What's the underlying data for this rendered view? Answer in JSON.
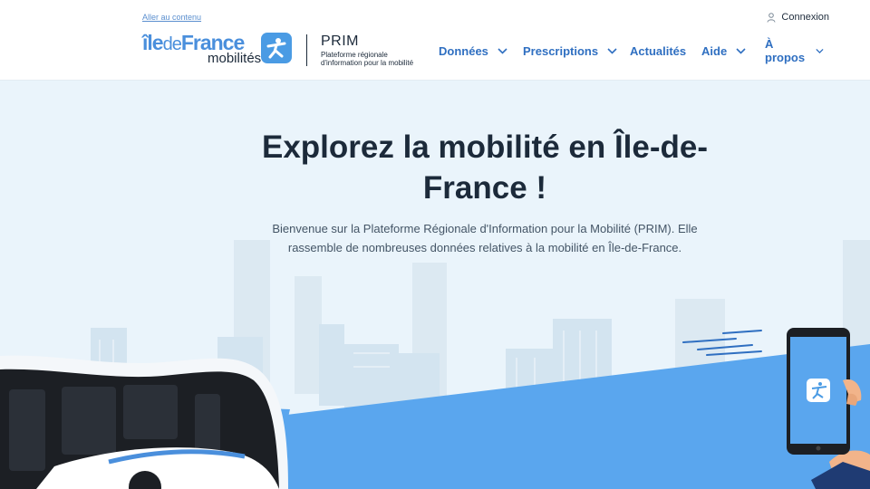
{
  "header": {
    "skip_link": "Aller au contenu",
    "login_label": "Connexion",
    "logo": {
      "main_part1": "île",
      "main_part2": "de",
      "main_part3": "France",
      "sub": "mobilités",
      "icon": "idfm-person-icon"
    },
    "platform": {
      "title": "PRIM",
      "subtitle": "Plateforme régionale d'information pour la mobilité"
    },
    "nav": [
      {
        "label": "Données",
        "has_dropdown": true
      },
      {
        "label": "Prescriptions",
        "has_dropdown": true
      },
      {
        "label": "Actualités",
        "has_dropdown": false
      },
      {
        "label": "Aide",
        "has_dropdown": true
      },
      {
        "label": "À propos",
        "has_dropdown": true
      }
    ]
  },
  "hero": {
    "title": "Explorez la mobilité en Île-de-France !",
    "description": "Bienvenue sur la Plateforme Régionale d'Information pour la Mobilité (PRIM). Elle rassemble de nombreuses données relatives à la mobilité en Île-de-France."
  },
  "colors": {
    "brand_blue": "#4a9be4",
    "nav_blue": "#2f6fc1",
    "text_dark": "#1c2a3a",
    "hero_bg": "#eaf4fb",
    "ground_blue": "#5aa6ee"
  }
}
